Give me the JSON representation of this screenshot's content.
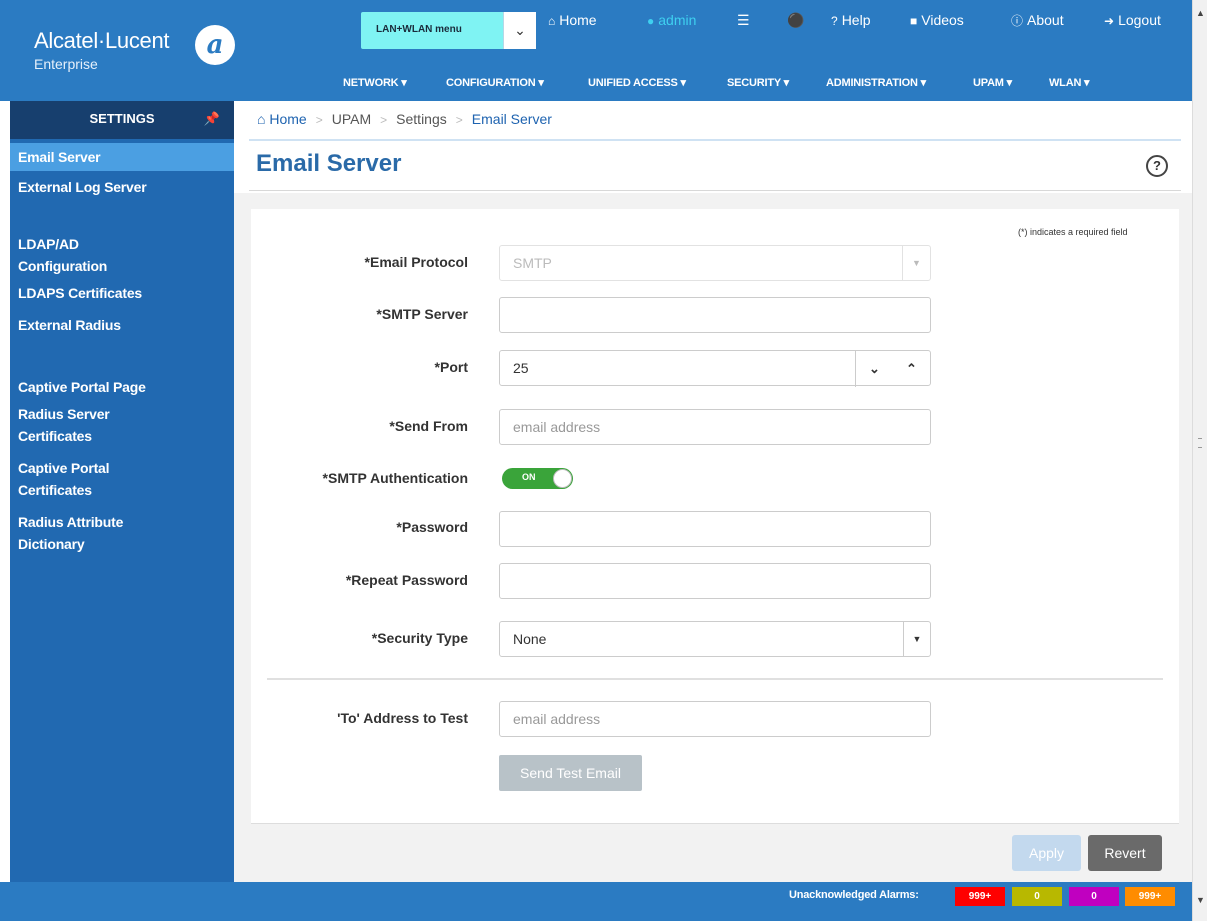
{
  "brand": {
    "name": "Alcatel·Lucent",
    "sub": "Enterprise",
    "logo_glyph": "a"
  },
  "header": {
    "menu_select_label": "LAN+WLAN menu",
    "top_links": {
      "home": "Home",
      "admin": "admin",
      "help": "Help",
      "videos": "Videos",
      "about": "About",
      "logout": "Logout"
    },
    "nav": [
      "NETWORK ▾",
      "CONFIGURATION ▾",
      "UNIFIED ACCESS ▾",
      "SECURITY ▾",
      "ADMINISTRATION ▾",
      "UPAM ▾",
      "WLAN ▾"
    ]
  },
  "sidebar": {
    "title": "SETTINGS",
    "items": [
      "Email Server",
      "External Log Server",
      "LDAP/AD Configuration",
      "LDAPS Certificates",
      "External Radius",
      "Captive Portal Page",
      "Radius Server Certificates",
      "Captive Portal Certificates",
      "Radius Attribute Dictionary"
    ],
    "active": "Email Server"
  },
  "breadcrumb": {
    "home": "Home",
    "b1": "UPAM",
    "b2": "Settings",
    "current": "Email Server"
  },
  "page": {
    "title": "Email Server",
    "required_note": "(*) indicates a required field"
  },
  "form": {
    "protocol_label": "*Email Protocol",
    "protocol_value": "SMTP",
    "smtp_server_label": "*SMTP Server",
    "smtp_server_value": "",
    "port_label": "*Port",
    "port_value": "25",
    "send_from_label": "*Send From",
    "send_from_placeholder": "email address",
    "smtp_auth_label": "*SMTP Authentication",
    "smtp_auth_toggle": "ON",
    "password_label": "*Password",
    "repeat_password_label": "*Repeat Password",
    "security_type_label": "*Security Type",
    "security_type_value": "None",
    "to_address_label": "'To' Address to Test",
    "to_address_placeholder": "email address",
    "send_test_label": "Send Test Email",
    "apply_label": "Apply",
    "revert_label": "Revert"
  },
  "status": {
    "alarms_label": "Unacknowledged Alarms:",
    "alarms": [
      {
        "value": "999+",
        "color": "#ff0000"
      },
      {
        "value": "0",
        "color": "#b8b800"
      },
      {
        "value": "0",
        "color": "#c000c0"
      },
      {
        "value": "999+",
        "color": "#ff8c00"
      }
    ]
  },
  "colors": {
    "header": "#2b7bc2",
    "sidebar": "#2169b1",
    "accent": "#2a6aa8",
    "toggle_on": "#3aa43a"
  }
}
